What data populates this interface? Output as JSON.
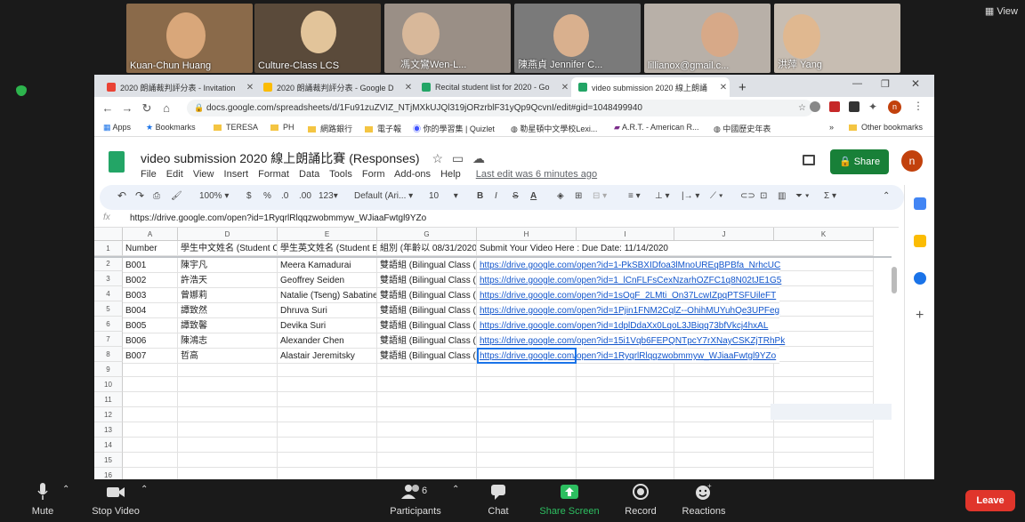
{
  "zoom": {
    "view_label": "View",
    "participants_tiles": [
      {
        "name": "Kuan-Chun Huang",
        "bg": "#8a6a4a"
      },
      {
        "name": "Culture-Class LCS",
        "bg": "#5a4a3a"
      },
      {
        "name": "馮文鸞Wen-L...",
        "bg": "#9a8f86"
      },
      {
        "name": "陳燕貞 Jennifer C...",
        "bg": "#7a7a7a"
      },
      {
        "name": "lillianox@gmail.c...",
        "bg": "#b8b0a8"
      },
      {
        "name": "洪萍 Yang",
        "bg": "#c7bdb2"
      }
    ],
    "controls": {
      "mute": "Mute",
      "stop_video": "Stop Video",
      "participants": "Participants",
      "participants_count": "6",
      "chat": "Chat",
      "share_screen": "Share Screen",
      "record": "Record",
      "reactions": "Reactions",
      "leave": "Leave"
    },
    "colors": {
      "share_green": "#2dbe60",
      "leave_red": "#e0352b"
    }
  },
  "browser": {
    "tabs": [
      {
        "label": "2020 朗誦裁判評分表 - Invitation",
        "icon": "gmail-icon",
        "color": "#ea4335"
      },
      {
        "label": "2020 朗誦裁判評分表 - Google D",
        "icon": "drive-icon",
        "color": "#fbbc04"
      },
      {
        "label": "Recital student list for 2020 - Go",
        "icon": "sheets-icon",
        "color": "#23a566"
      },
      {
        "label": "video submission 2020 線上朗誦",
        "icon": "sheets-icon",
        "color": "#23a566"
      }
    ],
    "url": "docs.google.com/spreadsheets/d/1Fu91zuZVIZ_NTjMXkUJQl319jORzrblF31yQp9QcvnI/edit#gid=1048499940",
    "bookmarks": [
      "Apps",
      "Bookmarks",
      "TERESA",
      "PH",
      "網路銀行",
      "電子報",
      "你的學習集 | Quizlet",
      "勒星頓中文學校Lexi...",
      "A.R.T. - American R...",
      "中國歷史年表",
      "Other bookmarks"
    ],
    "bookmarks_overflow": "»"
  },
  "sheet": {
    "title": "video submission 2020 線上朗誦比賽 (Responses)",
    "menu": [
      "File",
      "Edit",
      "View",
      "Insert",
      "Format",
      "Data",
      "Tools",
      "Form",
      "Add-ons",
      "Help"
    ],
    "last_edit": "Last edit was 6 minutes ago",
    "share_label": "Share",
    "avatar_letter": "n",
    "toolbar": {
      "zoom": "100%",
      "currency": "$",
      "percent": "%",
      "dec_dec": ".0",
      "dec_inc": ".00",
      "more_formats": "123",
      "font": "Default (Ari...",
      "font_size": "10",
      "bold": "B",
      "italic": "I",
      "strike": "S",
      "text_color": "A"
    },
    "formula": "https://drive.google.com/open?id=1RyqrlRlqqzwobmmyw_WJiaaFwtgl9YZo",
    "fx": "fx",
    "columns": [
      "A",
      "D",
      "E",
      "G",
      "H",
      "I",
      "J",
      "K"
    ],
    "header_row": {
      "A": "Number",
      "D": "學生中文姓名 (Student C",
      "E": "學生英文姓名 (Student E",
      "G": "組別 (年齡以 08/31/2020",
      "H": "Submit Your Video Here : Due Date: 11/14/2020"
    },
    "rows": [
      {
        "num": "B001",
        "zh": "陳宇凡",
        "en": "Meera Kamadurai",
        "group": "雙語組  (Bilingual Class (",
        "link": "https://drive.google.com/open?id=1-PkSBXIDfoa3lMnoUREqBPBfa_NrhcUC"
      },
      {
        "num": "B002",
        "zh": "許浩天",
        "en": "Geoffrey Seiden",
        "group": "雙語組  (Bilingual Class (",
        "link": "https://drive.google.com/open?id=1_lCnFLFsCexNzarhOZFC1q8N02tJE1G5"
      },
      {
        "num": "B003",
        "zh": "曾娜莉",
        "en": "Natalie (Tseng) Sabatine",
        "group": "雙語組  (Bilingual Class (",
        "link": "https://drive.google.com/open?id=1sOgF_2LMti_On37LcwIZpqPTSFUileFT"
      },
      {
        "num": "B004",
        "zh": "譚致然",
        "en": "Dhruva Suri",
        "group": "雙語組  (Bilingual Class (",
        "link": "https://drive.google.com/open?id=1Pjin1FNM2CqlZ--OhihMUYuhQe3UPFeg"
      },
      {
        "num": "B005",
        "zh": "譚致馨",
        "en": "Devika Suri",
        "group": "雙語組  (Bilingual Class (",
        "link": "https://drive.google.com/open?id=1dplDdaXx0LqoL3JBiqq73bfVkcj4hxAL"
      },
      {
        "num": "B006",
        "zh": "陳鴻志",
        "en": "Alexander Chen",
        "group": "雙語組  (Bilingual Class (",
        "link": "https://drive.google.com/open?id=15i1Vqb6FEPQNTpcY7rXNayCSKZjTRhPk"
      },
      {
        "num": "B007",
        "zh": "哲高",
        "en": "Alastair Jeremitsky",
        "group": "雙語組  (Bilingual Class (",
        "link": "https://drive.google.com/open?id=1RyqrlRlqqzwobmmyw_WJiaaFwtgl9YZo"
      }
    ],
    "row_numbers": [
      "1",
      "2",
      "3",
      "4",
      "5",
      "6",
      "7",
      "8",
      "9",
      "10",
      "11",
      "12",
      "13",
      "14",
      "15",
      "16"
    ]
  }
}
